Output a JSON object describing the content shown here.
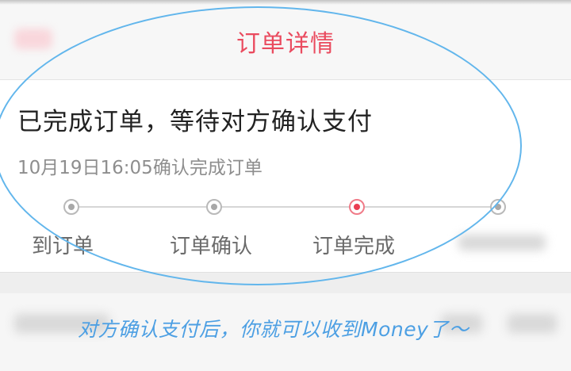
{
  "header": {
    "title": "订单详情"
  },
  "order": {
    "status_heading": "已完成订单，等待对方确认支付",
    "status_time": "10月19日16:05确认完成订单"
  },
  "progress": {
    "steps": [
      {
        "label": "到订单",
        "state": "done"
      },
      {
        "label": "订单确认",
        "state": "done"
      },
      {
        "label": "订单完成",
        "state": "current"
      },
      {
        "label": "",
        "state": "pending"
      }
    ]
  },
  "annotation": {
    "text": "对方确认支付后，你就可以收到Money了～",
    "color": "#4c9fe3"
  },
  "colors": {
    "accent": "#ea4b5f",
    "callout_outline": "#62b6ec"
  }
}
